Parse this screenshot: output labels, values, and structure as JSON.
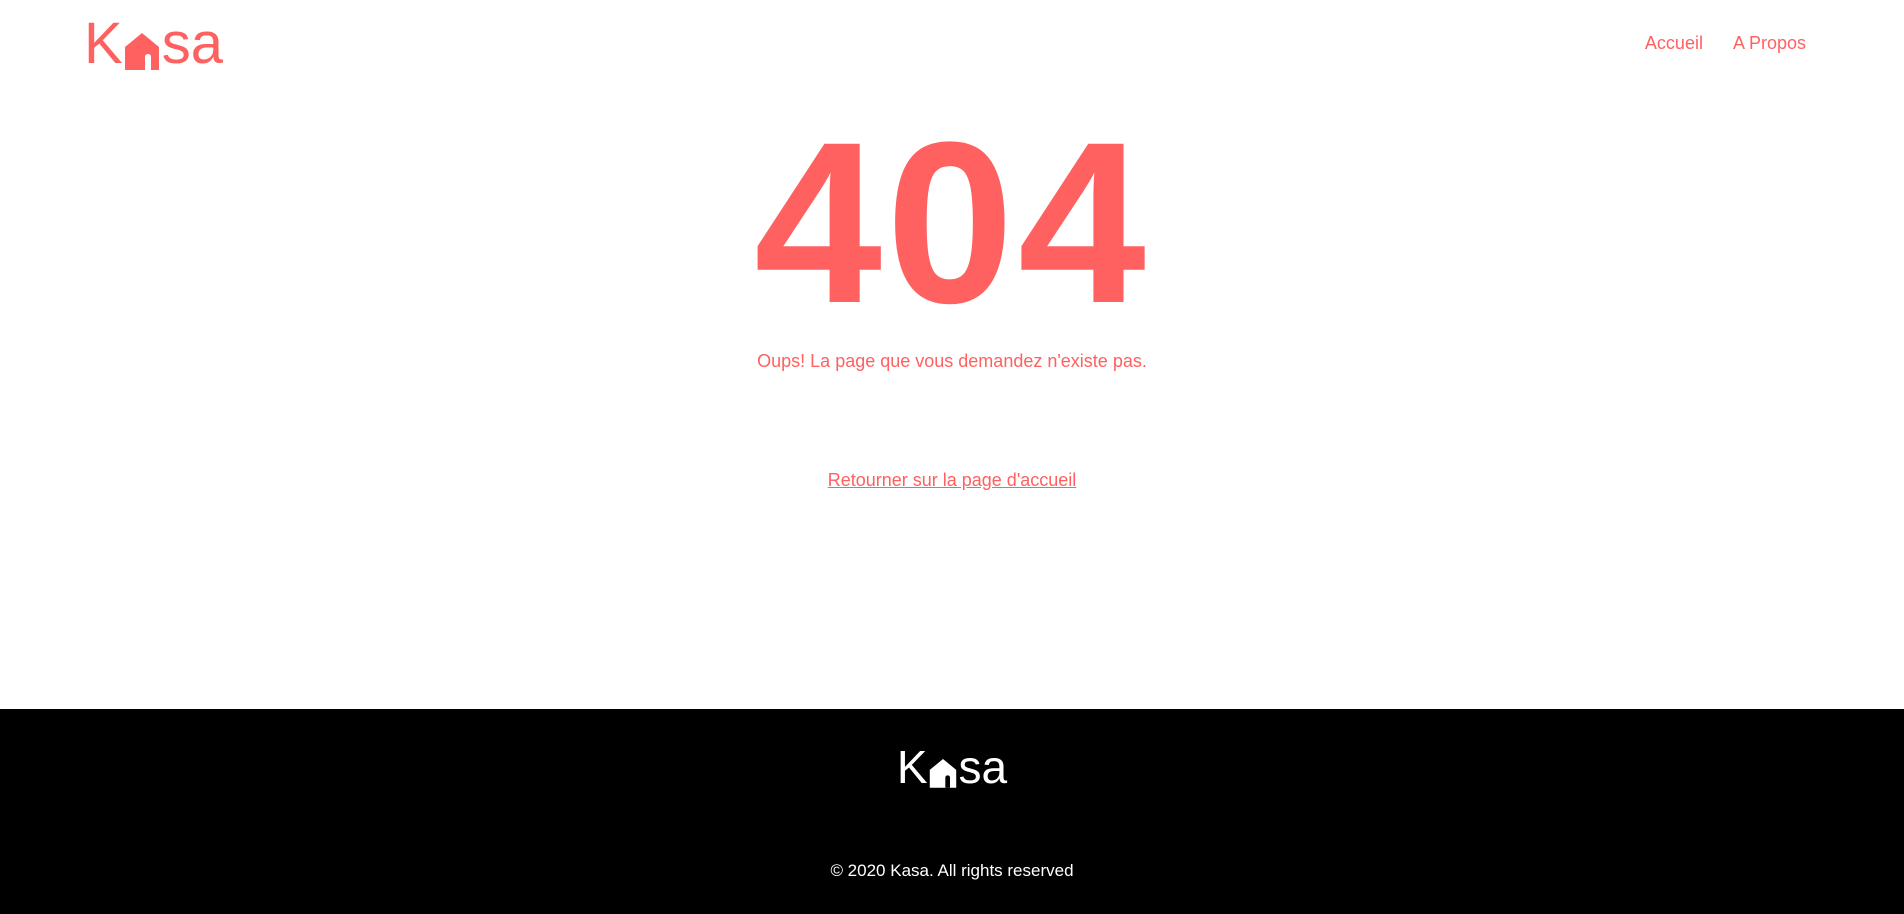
{
  "brand": {
    "logo_text": "Kasa",
    "color": "#FF6060"
  },
  "header": {
    "nav": {
      "home_label": "Accueil",
      "about_label": "A Propos"
    }
  },
  "main": {
    "error_code": "404",
    "message": "Oups! La page que vous demandez n'existe pas.",
    "back_link_label": "Retourner sur la page d'accueil"
  },
  "footer": {
    "logo_text": "Kasa",
    "copyright": "© 2020 Kasa. All rights reserved",
    "background": "#000000"
  },
  "icons": {
    "logo_house": "house-icon"
  }
}
